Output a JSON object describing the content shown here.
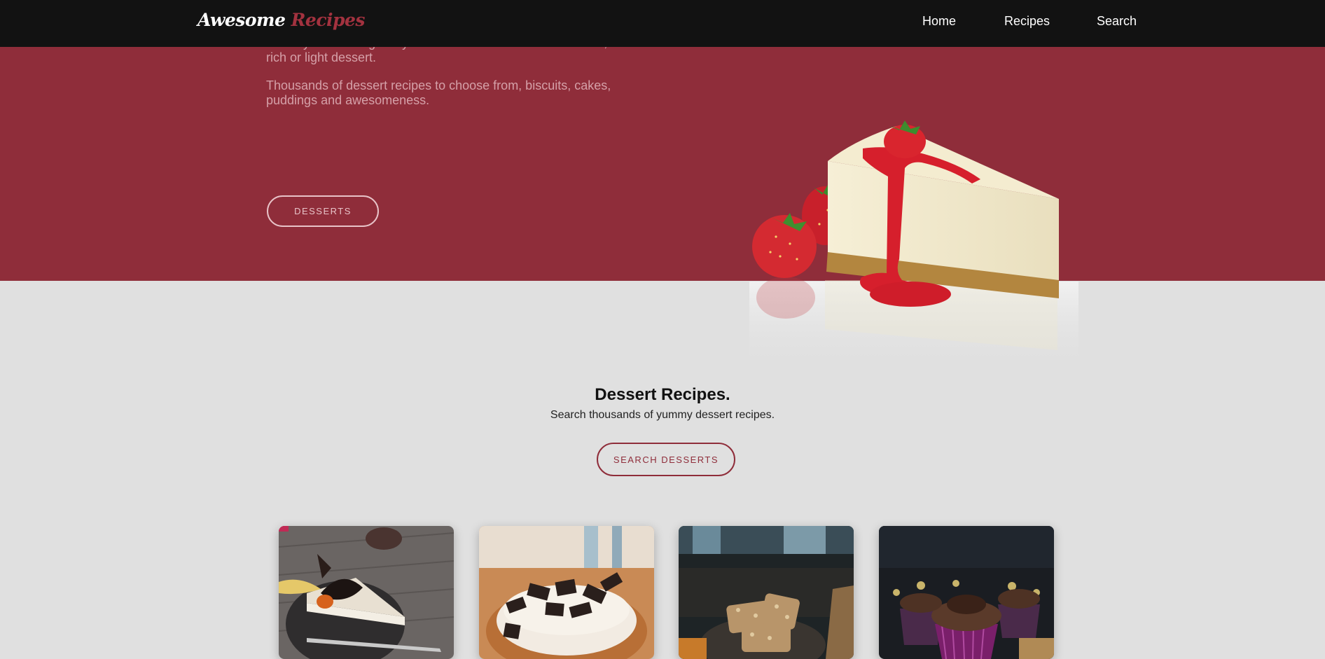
{
  "nav": {
    "logo_white": "Awesome",
    "logo_red": "Recipes",
    "links": [
      {
        "label": "Home"
      },
      {
        "label": "Recipes"
      },
      {
        "label": "Search"
      }
    ]
  },
  "hero": {
    "text_1": "Finish your evening in style with a delicious chocolate or fruit, rich or light dessert.",
    "text_2": "Thousands of dessert recipes to choose from, biscuits, cakes, puddings and awesomeness.",
    "button_label": "DESSERTS"
  },
  "section": {
    "title": "Dessert Recipes.",
    "subtitle": "Search thousands of yummy dessert recipes.",
    "button_label": "SEARCH DESSERTS"
  },
  "colors": {
    "brand_red": "#8f2d3a",
    "nav_bg": "#121212",
    "page_bg": "#e0e0e0"
  },
  "images": {
    "hero": "cheesecake-with-strawberries",
    "cards": [
      "chocolate-tart-slice",
      "cookies-and-cream-donut",
      "granola-bars",
      "chocolate-cupcakes"
    ]
  }
}
